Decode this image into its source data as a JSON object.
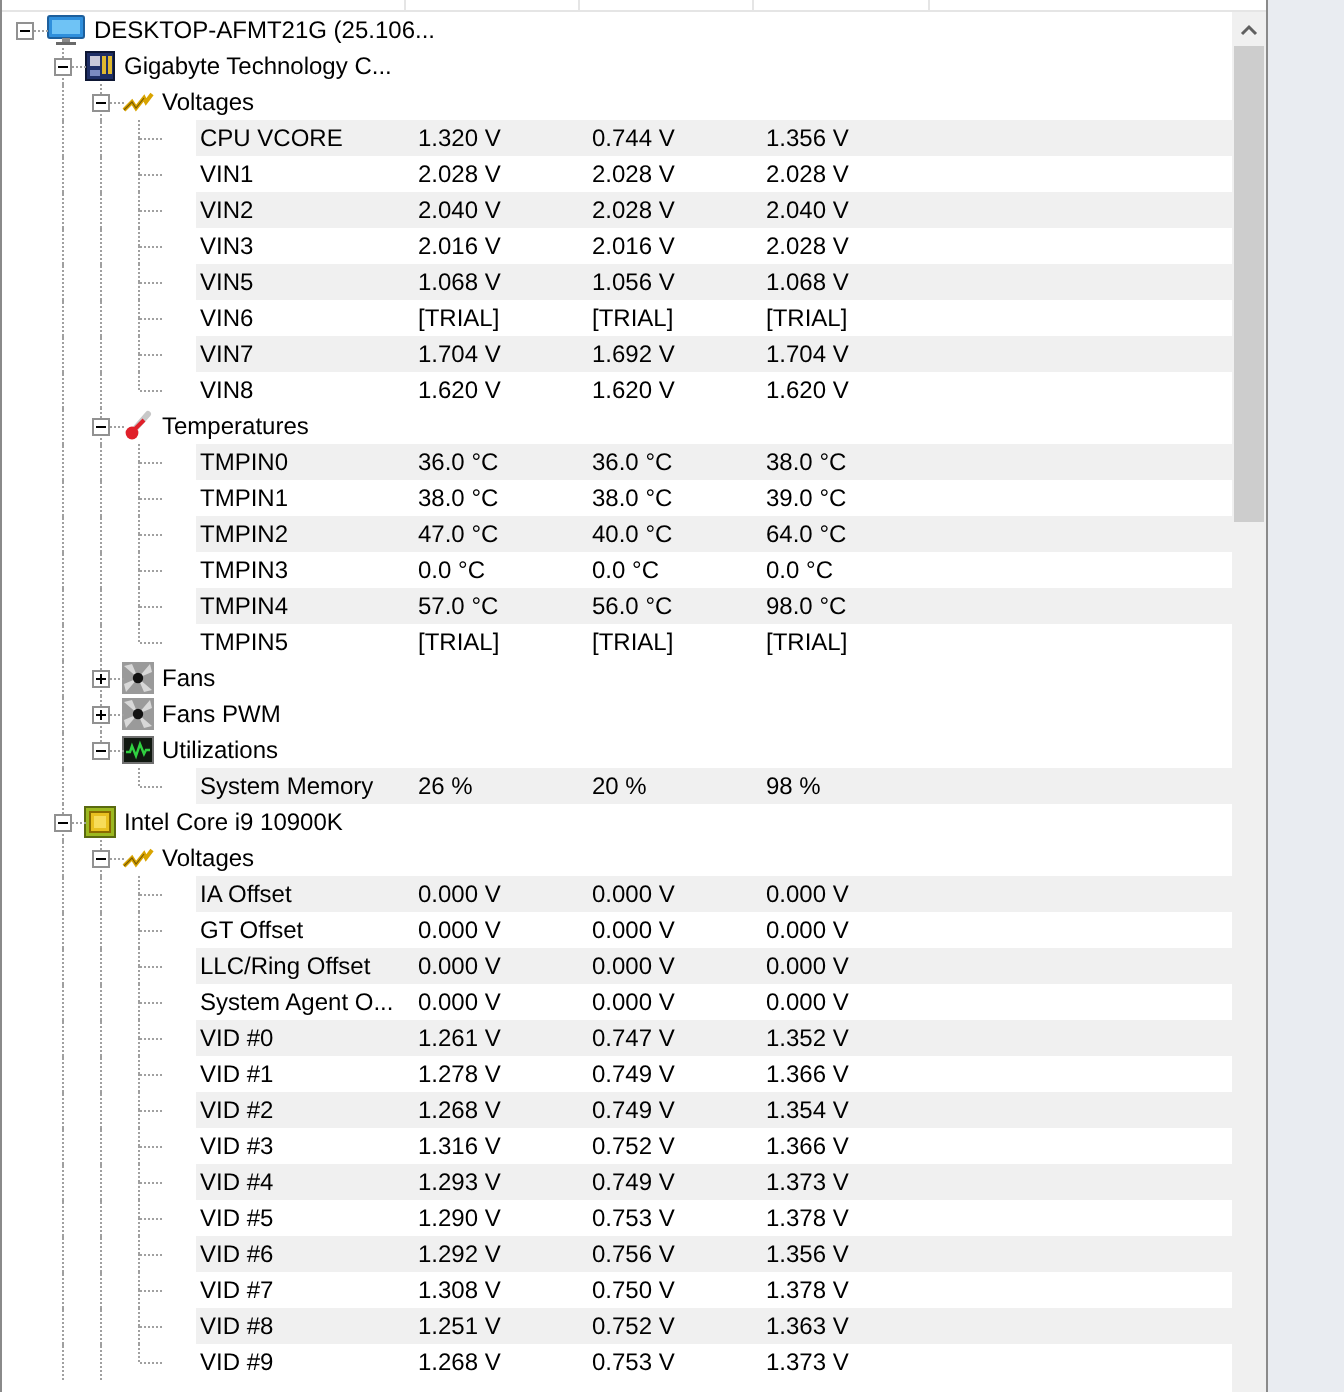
{
  "tree": {
    "continues": true,
    "nodes": [
      {
        "kind": "computer",
        "label": "DESKTOP-AFMT21G (25.106...",
        "expanded": true,
        "children": [
          {
            "kind": "motherboard",
            "label": "Gigabyte Technology C...",
            "expanded": true,
            "children": [
              {
                "kind": "voltage",
                "label": "Voltages",
                "expanded": true,
                "children": [
                  {
                    "kind": "sensor",
                    "name": "CPU VCORE",
                    "value": "1.320 V",
                    "min": "0.744 V",
                    "max": "1.356 V"
                  },
                  {
                    "kind": "sensor",
                    "name": "VIN1",
                    "value": "2.028 V",
                    "min": "2.028 V",
                    "max": "2.028 V"
                  },
                  {
                    "kind": "sensor",
                    "name": "VIN2",
                    "value": "2.040 V",
                    "min": "2.028 V",
                    "max": "2.040 V"
                  },
                  {
                    "kind": "sensor",
                    "name": "VIN3",
                    "value": "2.016 V",
                    "min": "2.016 V",
                    "max": "2.028 V"
                  },
                  {
                    "kind": "sensor",
                    "name": "VIN5",
                    "value": "1.068 V",
                    "min": "1.056 V",
                    "max": "1.068 V"
                  },
                  {
                    "kind": "sensor",
                    "name": "VIN6",
                    "value": "[TRIAL]",
                    "min": "[TRIAL]",
                    "max": "[TRIAL]"
                  },
                  {
                    "kind": "sensor",
                    "name": "VIN7",
                    "value": "1.704 V",
                    "min": "1.692 V",
                    "max": "1.704 V"
                  },
                  {
                    "kind": "sensor",
                    "name": "VIN8",
                    "value": "1.620 V",
                    "min": "1.620 V",
                    "max": "1.620 V"
                  }
                ]
              },
              {
                "kind": "temperature",
                "label": "Temperatures",
                "expanded": true,
                "children": [
                  {
                    "kind": "sensor",
                    "name": "TMPIN0",
                    "value": "36.0 °C",
                    "min": "36.0 °C",
                    "max": "38.0 °C"
                  },
                  {
                    "kind": "sensor",
                    "name": "TMPIN1",
                    "value": "38.0 °C",
                    "min": "38.0 °C",
                    "max": "39.0 °C"
                  },
                  {
                    "kind": "sensor",
                    "name": "TMPIN2",
                    "value": "47.0 °C",
                    "min": "40.0 °C",
                    "max": "64.0 °C"
                  },
                  {
                    "kind": "sensor",
                    "name": "TMPIN3",
                    "value": "0.0 °C",
                    "min": "0.0 °C",
                    "max": "0.0 °C"
                  },
                  {
                    "kind": "sensor",
                    "name": "TMPIN4",
                    "value": "57.0 °C",
                    "min": "56.0 °C",
                    "max": "98.0 °C"
                  },
                  {
                    "kind": "sensor",
                    "name": "TMPIN5",
                    "value": "[TRIAL]",
                    "min": "[TRIAL]",
                    "max": "[TRIAL]"
                  }
                ]
              },
              {
                "kind": "fan",
                "label": "Fans",
                "expanded": false
              },
              {
                "kind": "fan",
                "label": "Fans PWM",
                "expanded": false
              },
              {
                "kind": "utilization",
                "label": "Utilizations",
                "expanded": true,
                "children": [
                  {
                    "kind": "sensor",
                    "name": "System Memory",
                    "value": "26 %",
                    "min": "20 %",
                    "max": "98 %"
                  }
                ]
              }
            ]
          },
          {
            "kind": "cpu",
            "label": "Intel Core i9 10900K",
            "expanded": true,
            "children": [
              {
                "kind": "voltage",
                "label": "Voltages",
                "expanded": true,
                "children": [
                  {
                    "kind": "sensor",
                    "name": "IA Offset",
                    "value": "0.000 V",
                    "min": "0.000 V",
                    "max": "0.000 V"
                  },
                  {
                    "kind": "sensor",
                    "name": "GT Offset",
                    "value": "0.000 V",
                    "min": "0.000 V",
                    "max": "0.000 V"
                  },
                  {
                    "kind": "sensor",
                    "name": "LLC/Ring Offset",
                    "value": "0.000 V",
                    "min": "0.000 V",
                    "max": "0.000 V"
                  },
                  {
                    "kind": "sensor",
                    "name": "System Agent O...",
                    "value": "0.000 V",
                    "min": "0.000 V",
                    "max": "0.000 V"
                  },
                  {
                    "kind": "sensor",
                    "name": "VID #0",
                    "value": "1.261 V",
                    "min": "0.747 V",
                    "max": "1.352 V"
                  },
                  {
                    "kind": "sensor",
                    "name": "VID #1",
                    "value": "1.278 V",
                    "min": "0.749 V",
                    "max": "1.366 V"
                  },
                  {
                    "kind": "sensor",
                    "name": "VID #2",
                    "value": "1.268 V",
                    "min": "0.749 V",
                    "max": "1.354 V"
                  },
                  {
                    "kind": "sensor",
                    "name": "VID #3",
                    "value": "1.316 V",
                    "min": "0.752 V",
                    "max": "1.366 V"
                  },
                  {
                    "kind": "sensor",
                    "name": "VID #4",
                    "value": "1.293 V",
                    "min": "0.749 V",
                    "max": "1.373 V"
                  },
                  {
                    "kind": "sensor",
                    "name": "VID #5",
                    "value": "1.290 V",
                    "min": "0.753 V",
                    "max": "1.378 V"
                  },
                  {
                    "kind": "sensor",
                    "name": "VID #6",
                    "value": "1.292 V",
                    "min": "0.756 V",
                    "max": "1.356 V"
                  },
                  {
                    "kind": "sensor",
                    "name": "VID #7",
                    "value": "1.308 V",
                    "min": "0.750 V",
                    "max": "1.378 V"
                  },
                  {
                    "kind": "sensor",
                    "name": "VID #8",
                    "value": "1.251 V",
                    "min": "0.752 V",
                    "max": "1.363 V"
                  },
                  {
                    "kind": "sensor",
                    "name": "VID #9",
                    "value": "1.268 V",
                    "min": "0.753 V",
                    "max": "1.373 V"
                  }
                ]
              }
            ]
          }
        ]
      }
    ]
  }
}
